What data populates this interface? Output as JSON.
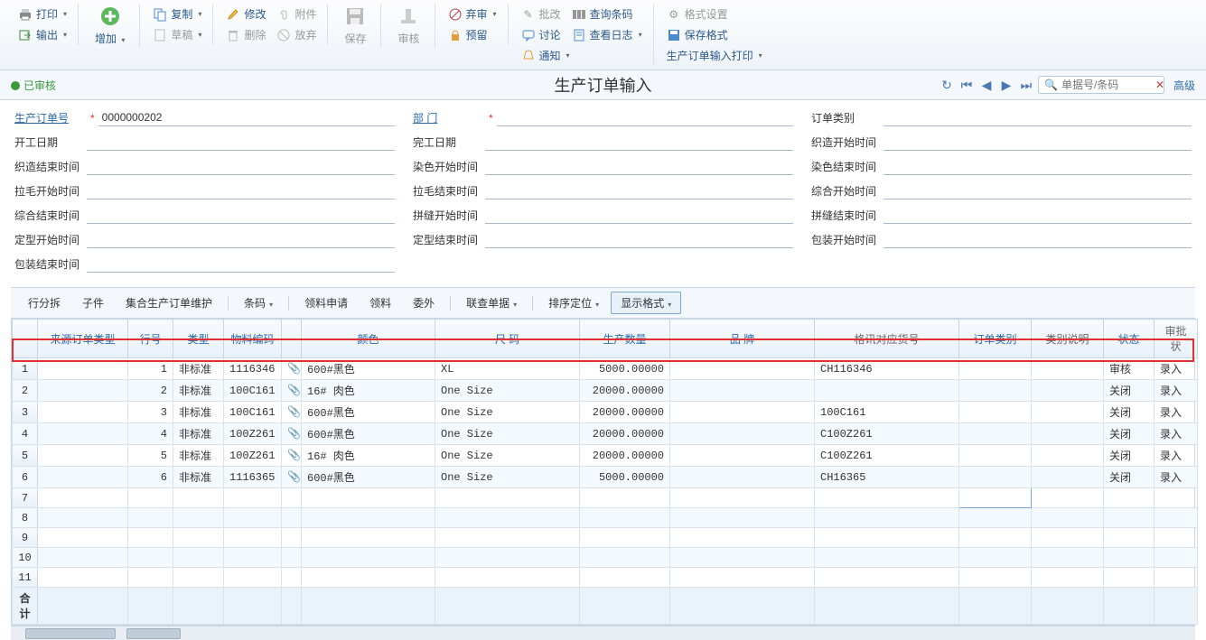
{
  "toolbar": {
    "print": "打印",
    "output": "输出",
    "add": "增加",
    "copy": "复制",
    "modify": "修改",
    "attach": "附件",
    "draft": "草稿",
    "delete": "删除",
    "save": "保存",
    "void": "放弃",
    "audit": "审核",
    "abandon_audit": "弃审",
    "preview": "预留",
    "batch": "批改",
    "discuss": "讨论",
    "notify": "通知",
    "query_barcode": "查询条码",
    "view_log": "查看日志",
    "format_set": "格式设置",
    "save_format": "保存格式",
    "print_order": "生产订单输入打印"
  },
  "header": {
    "status": "已审核",
    "title": "生产订单输入",
    "search_placeholder": "单据号/条码",
    "advanced": "高级"
  },
  "form": {
    "left": [
      {
        "label": "生产订单号",
        "link": true,
        "req": true,
        "value": "0000000202"
      },
      {
        "label": "开工日期",
        "value": ""
      },
      {
        "label": "织造结束时间",
        "value": ""
      },
      {
        "label": "拉毛开始时间",
        "value": ""
      },
      {
        "label": "综合结束时间",
        "value": ""
      },
      {
        "label": "定型开始时间",
        "value": ""
      },
      {
        "label": "包装结束时间",
        "value": ""
      }
    ],
    "mid": [
      {
        "label": "部 门",
        "link": true,
        "req": true,
        "value": ""
      },
      {
        "label": "完工日期",
        "value": ""
      },
      {
        "label": "染色开始时间",
        "value": ""
      },
      {
        "label": "拉毛结束时间",
        "value": ""
      },
      {
        "label": "拼缝开始时间",
        "value": ""
      },
      {
        "label": "定型结束时间",
        "value": ""
      }
    ],
    "right": [
      {
        "label": "订单类别",
        "value": ""
      },
      {
        "label": "织造开始时间",
        "value": ""
      },
      {
        "label": "染色结束时间",
        "value": ""
      },
      {
        "label": "综合开始时间",
        "value": ""
      },
      {
        "label": "拼缝结束时间",
        "value": ""
      },
      {
        "label": "包装开始时间",
        "value": ""
      }
    ]
  },
  "subtoolbar": {
    "row_split": "行分拆",
    "child_part": "子件",
    "batch_maint": "集合生产订单维护",
    "barcode": "条码",
    "req_apply": "领料申请",
    "req": "领料",
    "outsource": "委外",
    "linked_docs": "联查单据",
    "sort": "排序定位",
    "display_format": "显示格式"
  },
  "grid": {
    "headers": [
      "",
      "来源订单类型",
      "行号",
      "类型",
      "物料编码",
      "",
      "颜色",
      "尺 码",
      "生产数量",
      "品 牌",
      "格讯对应货号",
      "订单类别",
      "类别说明",
      "状态",
      "审批状"
    ],
    "header_links": [
      false,
      true,
      true,
      true,
      true,
      false,
      true,
      true,
      true,
      true,
      false,
      true,
      false,
      true,
      false
    ],
    "rows": [
      {
        "n": "1",
        "line": "1",
        "type": "非标准",
        "mat": "1116346",
        "color": "600#黑色",
        "size": "XL",
        "qty": "5000.00000",
        "code": "CH116346",
        "status": "审核",
        "approve": "录入"
      },
      {
        "n": "2",
        "line": "2",
        "type": "非标准",
        "mat": "100C161",
        "color": "16# 肉色",
        "size": "One Size",
        "qty": "20000.00000",
        "code": "",
        "status": "关闭",
        "approve": "录入"
      },
      {
        "n": "3",
        "line": "3",
        "type": "非标准",
        "mat": "100C161",
        "color": "600#黑色",
        "size": "One Size",
        "qty": "20000.00000",
        "code": "100C161",
        "status": "关闭",
        "approve": "录入"
      },
      {
        "n": "4",
        "line": "4",
        "type": "非标准",
        "mat": "100Z261",
        "color": "600#黑色",
        "size": "One Size",
        "qty": "20000.00000",
        "code": "C100Z261",
        "status": "关闭",
        "approve": "录入"
      },
      {
        "n": "5",
        "line": "5",
        "type": "非标准",
        "mat": "100Z261",
        "color": "16# 肉色",
        "size": "One Size",
        "qty": "20000.00000",
        "code": "C100Z261",
        "status": "关闭",
        "approve": "录入"
      },
      {
        "n": "6",
        "line": "6",
        "type": "非标准",
        "mat": "1116365",
        "color": "600#黑色",
        "size": "One Size",
        "qty": "5000.00000",
        "code": "CH16365",
        "status": "关闭",
        "approve": "录入"
      }
    ],
    "empty_rows": [
      "7",
      "8",
      "9",
      "10",
      "11"
    ],
    "total_label": "合计"
  }
}
